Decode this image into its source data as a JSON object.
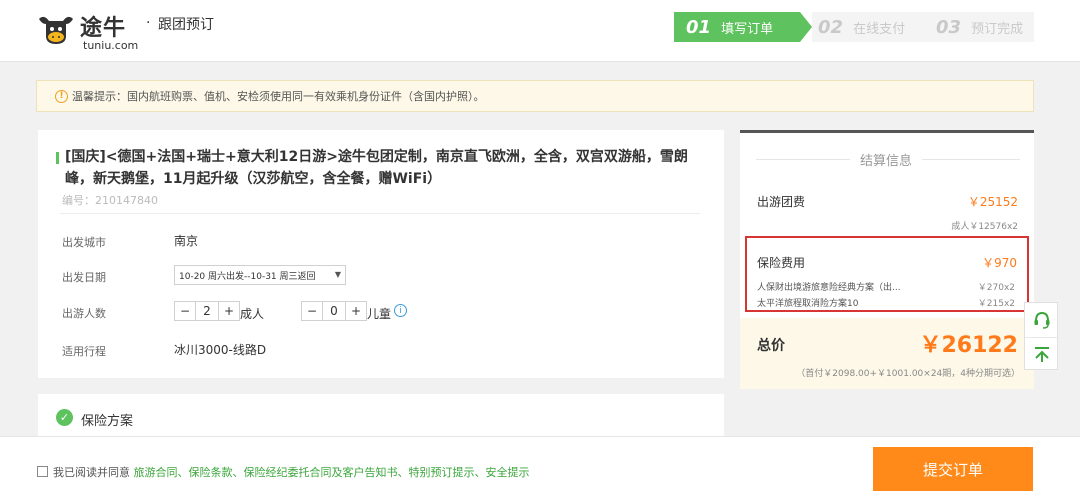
{
  "header": {
    "brand_name": "途牛",
    "brand_url": "tuniu.com",
    "brand_sep": "·",
    "brand_sub": "跟团预订",
    "steps": [
      {
        "num": "01",
        "label": "填写订单"
      },
      {
        "num": "02",
        "label": "在线支付"
      },
      {
        "num": "03",
        "label": "预订完成"
      }
    ]
  },
  "notice": {
    "icon": "!",
    "text": "温馨提示：国内航班购票、值机、安检须使用同一有效乘机身份证件（含国内护照）。"
  },
  "order": {
    "title": "[国庆]<德国+法国+瑞士+意大利12日游>途牛包团定制，南京直飞欧洲，全含，双宫双游船，雪朗峰，新天鹅堡，11月起升级（汉莎航空，含全餐，赠WiFi）",
    "number": "编号：210147840",
    "departure_city_label": "出发城市",
    "departure_city": "南京",
    "departure_date_label": "出发日期",
    "departure_date": "10-20 周六出发--10-31 周三返回",
    "travelers_label": "出游人数",
    "adults": "2",
    "adults_label": "成人",
    "children": "0",
    "children_label": "儿童",
    "route_label": "适用行程",
    "route": "冰川3000-线路D"
  },
  "insurance": {
    "title": "保险方案"
  },
  "summary": {
    "title": "结算信息",
    "tour_fee_label": "出游团费",
    "tour_fee": "￥25152",
    "tour_fee_detail": "成人￥12576x2",
    "insurance_label": "保险费用",
    "insurance_fee": "￥970",
    "insurance_items": [
      {
        "name": "人保财出境游旅意险经典方案（出...",
        "price": "￥270x2"
      },
      {
        "name": "太平洋旅程取消险方案10",
        "price": "￥215x2"
      }
    ],
    "total_label": "总价",
    "total": "￥26122",
    "installment_note": "（首付￥2098.00+￥1001.00×24期，4种分期可选）"
  },
  "footer": {
    "agree_prefix": "我已阅读并同意",
    "agree_links": "旅游合同、保险条款、保险经纪委托合同及客户告知书、特别预订提示、安全提示",
    "submit_label": "提交订单"
  },
  "colors": {
    "brand_green": "#5ec35e",
    "accent_orange": "#ff8a1a",
    "highlight_red": "#d93434"
  }
}
